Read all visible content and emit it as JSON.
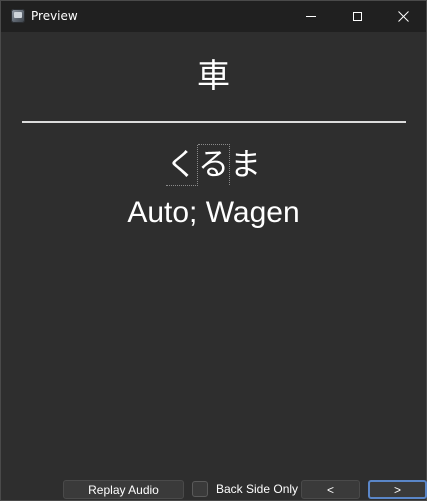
{
  "window": {
    "title": "Preview",
    "icon": "app-icon",
    "controls": {
      "minimize_icon": "minimize-icon",
      "maximize_icon": "maximize-icon",
      "close_icon": "close-icon",
      "close_glyph": "✕"
    }
  },
  "card": {
    "front": "車",
    "reading_part1": "く",
    "reading_part2": "る",
    "reading_part3": "ま",
    "meaning": "Auto; Wagen"
  },
  "toolbar": {
    "replay_label": "Replay Audio",
    "back_side_only_label": "Back Side Only",
    "back_side_only_checked": false,
    "prev_label": "<",
    "next_label": ">"
  },
  "colors": {
    "background": "#2e2e2e",
    "titlebar": "#202020",
    "text": "#ffffff",
    "focus_border": "#5a86c8"
  }
}
